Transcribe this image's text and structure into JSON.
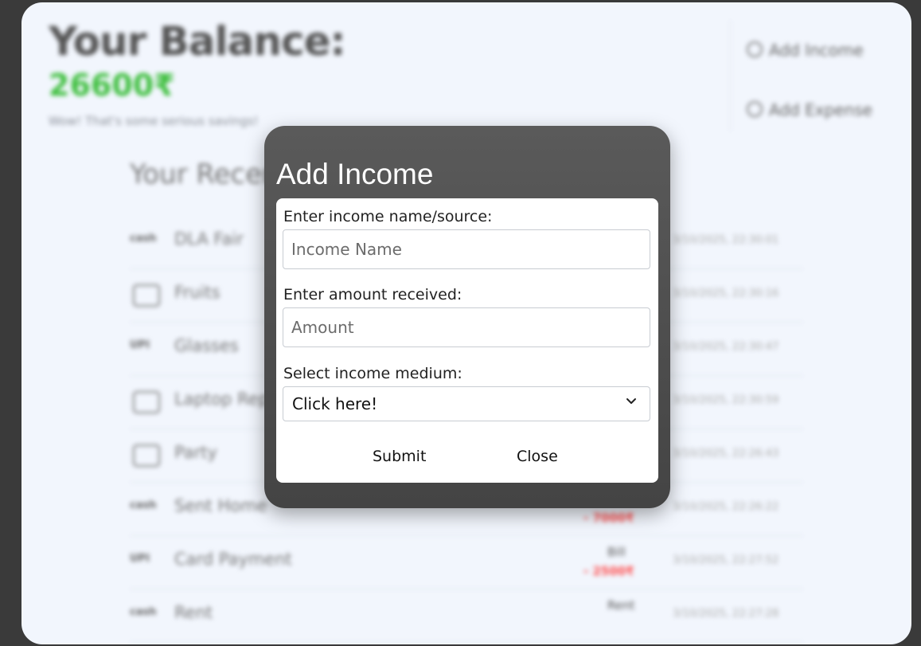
{
  "background": {
    "balance_title": "Your Balance:",
    "balance_value": "26600₹",
    "balance_note": "Wow! That's some serious savings!",
    "actions": [
      "Add Income",
      "Add Expense"
    ],
    "recent_title": "Your Recent Transactions",
    "transactions": [
      {
        "badge": "cash",
        "name": "DLA Fair",
        "timestamp": "3/10/2025, 22:30:01",
        "amount": "",
        "tag": ""
      },
      {
        "badge": "",
        "name": "Fruits",
        "timestamp": "3/10/2025, 22:30:16",
        "amount": "",
        "tag": ""
      },
      {
        "badge": "UPI",
        "name": "Glasses",
        "timestamp": "3/10/2025, 22:30:47",
        "amount": "",
        "tag": ""
      },
      {
        "badge": "",
        "name": "Laptop Repair",
        "timestamp": "3/10/2025, 22:30:59",
        "amount": "",
        "tag": ""
      },
      {
        "badge": "",
        "name": "Party",
        "timestamp": "3/10/2025, 22:26:43",
        "amount": "",
        "tag": ""
      },
      {
        "badge": "cash",
        "name": "Sent Home",
        "timestamp": "3/10/2025, 22:26:22",
        "amount": "- 7000₹",
        "tag": ""
      },
      {
        "badge": "UPI",
        "name": "Card Payment",
        "timestamp": "3/10/2025, 22:27:52",
        "amount": "- 2500₹",
        "tag": "Bill"
      },
      {
        "badge": "cash",
        "name": "Rent",
        "timestamp": "3/10/2025, 22:27:28",
        "amount": "",
        "tag": "Rent"
      }
    ]
  },
  "modal": {
    "title": "Add Income",
    "name_label": "Enter income name/source:",
    "name_placeholder": "Income Name",
    "amount_label": "Enter amount received:",
    "amount_placeholder": "Amount",
    "medium_label": "Select income medium:",
    "medium_selected": "Click here!",
    "submit_label": "Submit",
    "close_label": "Close"
  },
  "colors": {
    "modal_bg": "#4f4f4f",
    "app_bg": "#f2f6fd",
    "balance_green": "#3fbf3f",
    "expense_red": "#ff4b4b"
  }
}
